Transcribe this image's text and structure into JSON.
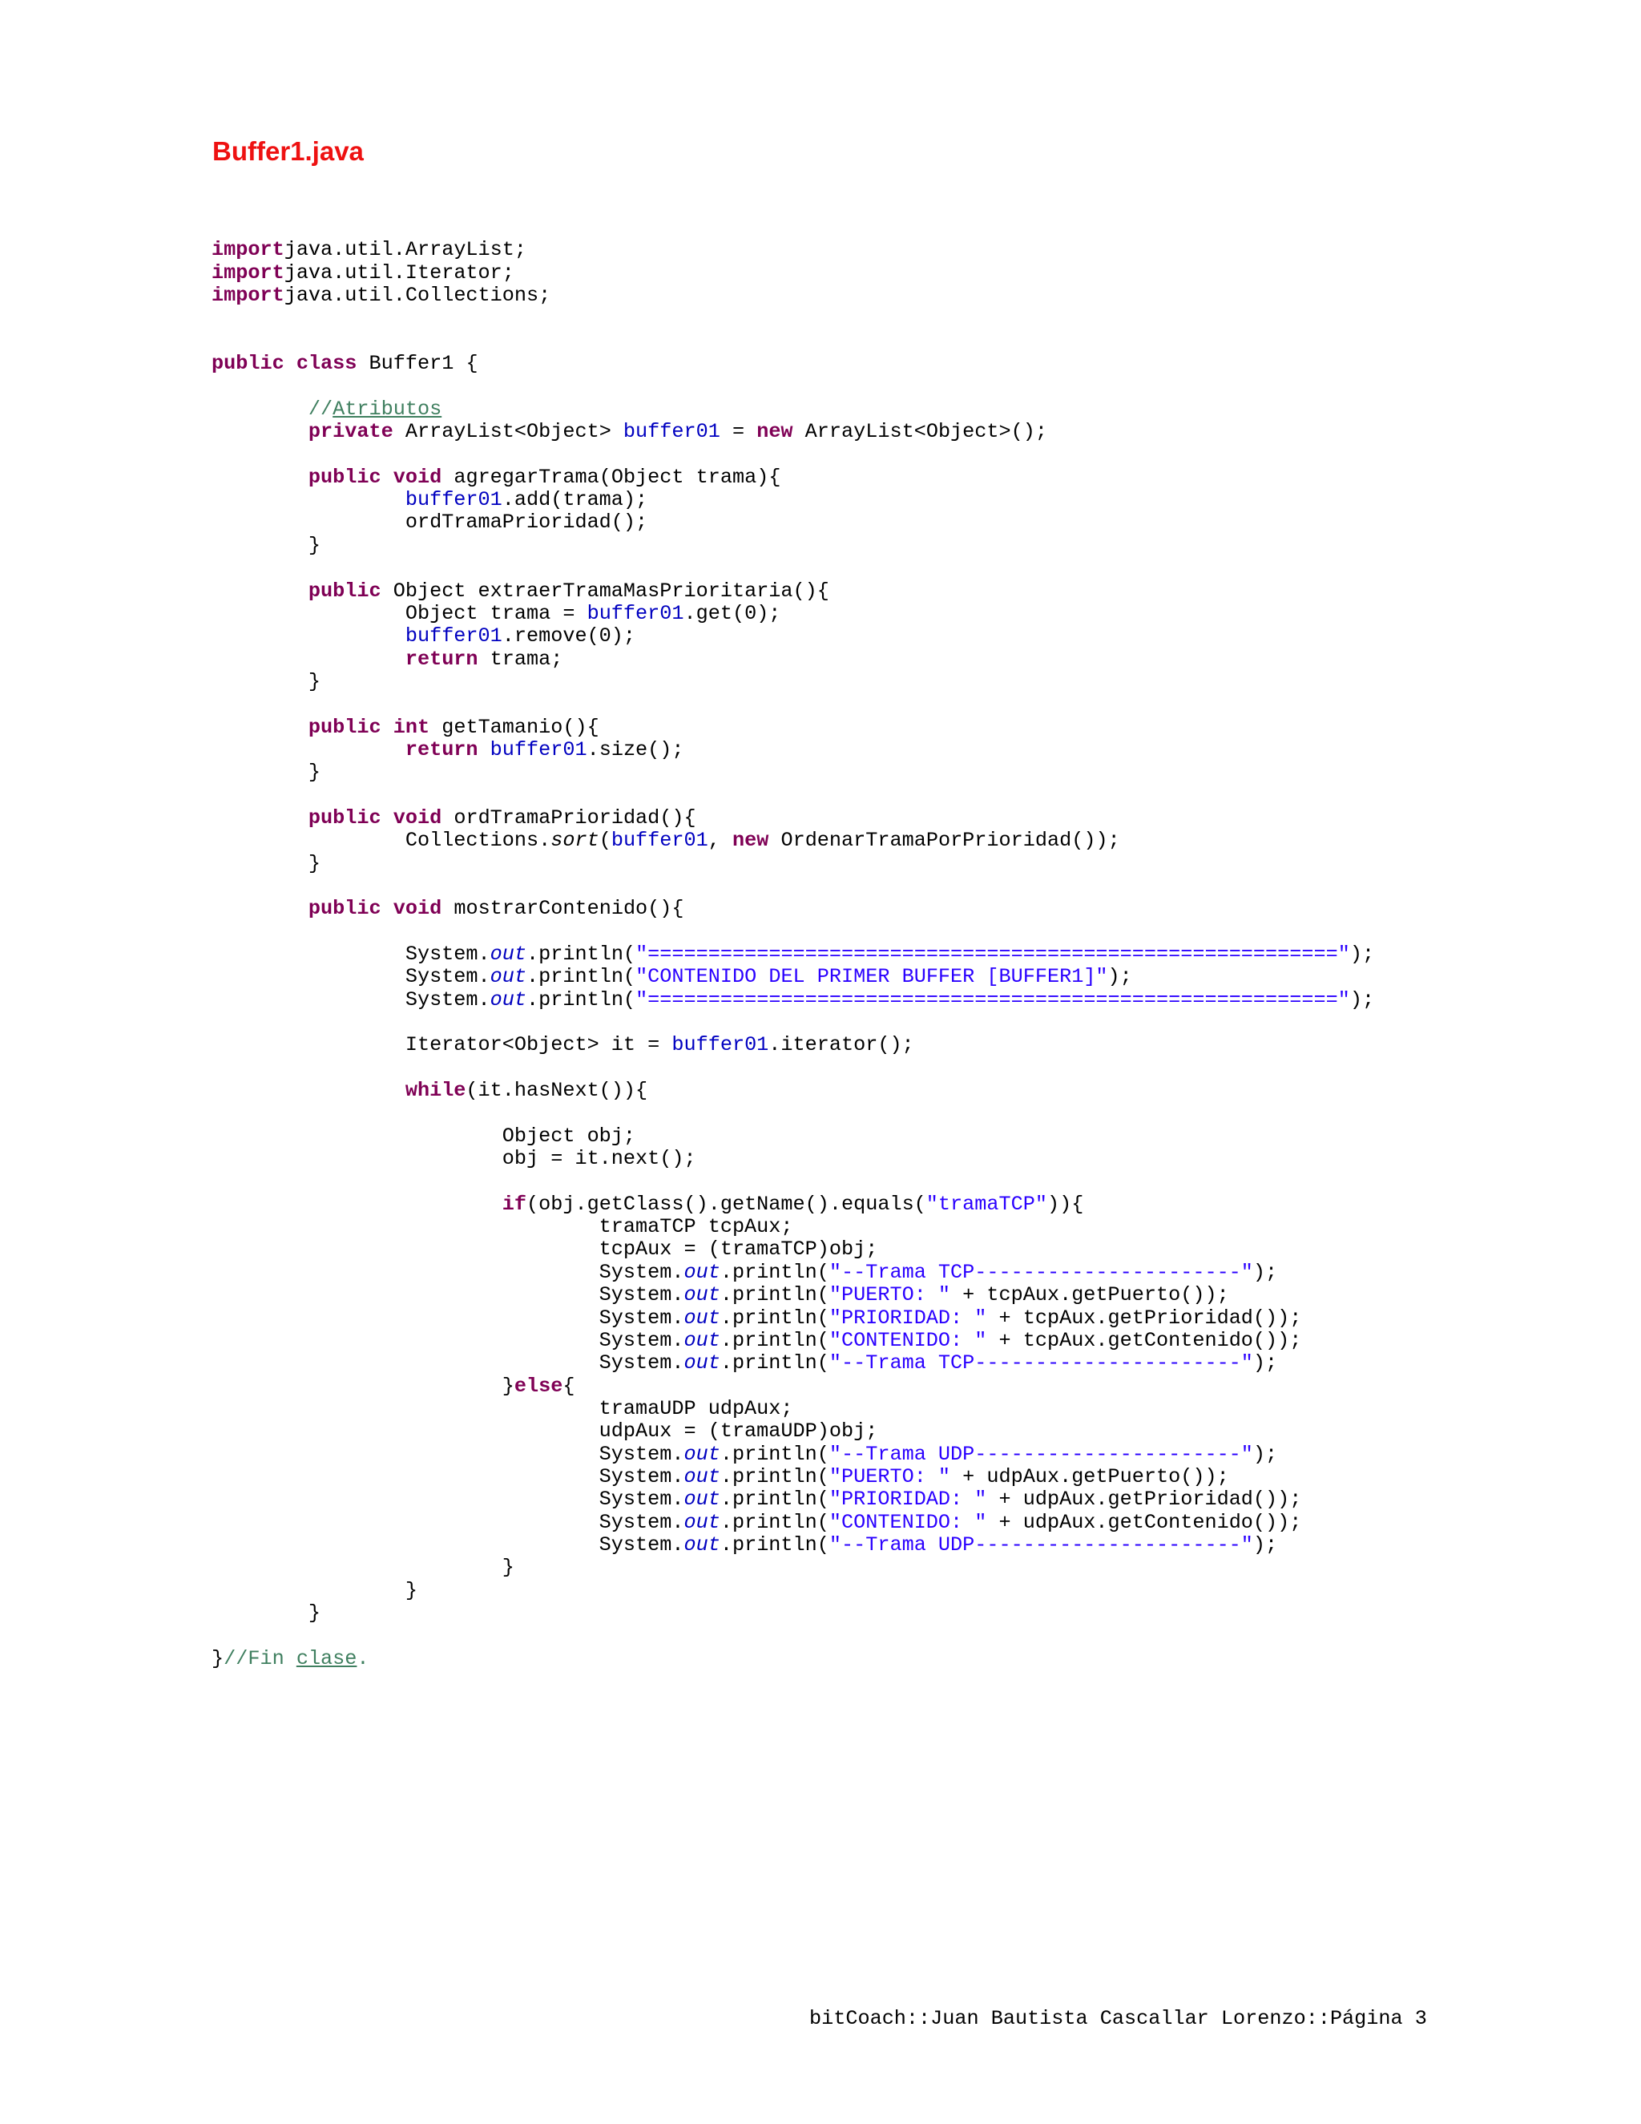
{
  "document": {
    "title": "Buffer1.java",
    "footer": "bitCoach::Juan Bautista Cascallar Lorenzo::Página 3"
  },
  "code": [
    [],
    [
      [
        "kw",
        "import"
      ],
      [
        "",
        "java.util.ArrayList;"
      ]
    ],
    [
      [
        "kw",
        "import"
      ],
      [
        "",
        "java.util.Iterator;"
      ]
    ],
    [
      [
        "kw",
        "import"
      ],
      [
        "",
        "java.util.Collections;"
      ]
    ],
    [],
    [],
    [
      [
        "kw",
        "public"
      ],
      [
        "",
        " "
      ],
      [
        "kw",
        "class"
      ],
      [
        "",
        " Buffer1 {"
      ]
    ],
    [],
    [
      [
        "",
        "        "
      ],
      [
        "cmt",
        "//"
      ],
      [
        "cmt-u",
        "Atributos"
      ]
    ],
    [
      [
        "",
        "        "
      ],
      [
        "kw",
        "private"
      ],
      [
        "",
        " ArrayList<Object> "
      ],
      [
        "fld",
        "buffer01"
      ],
      [
        "",
        " = "
      ],
      [
        "kw",
        "new"
      ],
      [
        "",
        " ArrayList<Object>();"
      ]
    ],
    [],
    [
      [
        "",
        "        "
      ],
      [
        "kw",
        "public"
      ],
      [
        "",
        " "
      ],
      [
        "kw",
        "void"
      ],
      [
        "",
        " agregarTrama(Object trama){"
      ]
    ],
    [
      [
        "",
        "                "
      ],
      [
        "fld",
        "buffer01"
      ],
      [
        "",
        ".add(trama);"
      ]
    ],
    [
      [
        "",
        "                ordTramaPrioridad();"
      ]
    ],
    [
      [
        "",
        "        }"
      ]
    ],
    [],
    [
      [
        "",
        "        "
      ],
      [
        "kw",
        "public"
      ],
      [
        "",
        " Object extraerTramaMasPrioritaria(){"
      ]
    ],
    [
      [
        "",
        "                Object trama = "
      ],
      [
        "fld",
        "buffer01"
      ],
      [
        "",
        ".get(0);"
      ]
    ],
    [
      [
        "",
        "                "
      ],
      [
        "fld",
        "buffer01"
      ],
      [
        "",
        ".remove(0);"
      ]
    ],
    [
      [
        "",
        "                "
      ],
      [
        "kw",
        "return"
      ],
      [
        "",
        " trama;"
      ]
    ],
    [
      [
        "",
        "        }"
      ]
    ],
    [],
    [
      [
        "",
        "        "
      ],
      [
        "kw",
        "public"
      ],
      [
        "",
        " "
      ],
      [
        "kw",
        "int"
      ],
      [
        "",
        " getTamanio(){"
      ]
    ],
    [
      [
        "",
        "                "
      ],
      [
        "kw",
        "return"
      ],
      [
        "",
        " "
      ],
      [
        "fld",
        "buffer01"
      ],
      [
        "",
        ".size();"
      ]
    ],
    [
      [
        "",
        "        }"
      ]
    ],
    [],
    [
      [
        "",
        "        "
      ],
      [
        "kw",
        "public"
      ],
      [
        "",
        " "
      ],
      [
        "kw",
        "void"
      ],
      [
        "",
        " ordTramaPrioridad(){"
      ]
    ],
    [
      [
        "",
        "                Collections."
      ],
      [
        "sm",
        "sort"
      ],
      [
        "",
        "("
      ],
      [
        "fld",
        "buffer01"
      ],
      [
        "",
        ", "
      ],
      [
        "kw",
        "new"
      ],
      [
        "",
        " OrdenarTramaPorPrioridad());"
      ]
    ],
    [
      [
        "",
        "        }"
      ]
    ],
    [],
    [
      [
        "",
        "        "
      ],
      [
        "kw",
        "public"
      ],
      [
        "",
        " "
      ],
      [
        "kw",
        "void"
      ],
      [
        "",
        " mostrarContenido(){"
      ]
    ],
    [],
    [
      [
        "",
        "                System."
      ],
      [
        "sfld",
        "out"
      ],
      [
        "",
        ".println("
      ],
      [
        "str",
        "\"=========================================================\""
      ],
      [
        "",
        ");"
      ]
    ],
    [
      [
        "",
        "                System."
      ],
      [
        "sfld",
        "out"
      ],
      [
        "",
        ".println("
      ],
      [
        "str",
        "\"CONTENIDO DEL PRIMER BUFFER [BUFFER1]\""
      ],
      [
        "",
        ");"
      ]
    ],
    [
      [
        "",
        "                System."
      ],
      [
        "sfld",
        "out"
      ],
      [
        "",
        ".println("
      ],
      [
        "str",
        "\"=========================================================\""
      ],
      [
        "",
        ");"
      ]
    ],
    [],
    [
      [
        "",
        "                Iterator<Object> it = "
      ],
      [
        "fld",
        "buffer01"
      ],
      [
        "",
        ".iterator();"
      ]
    ],
    [],
    [
      [
        "",
        "                "
      ],
      [
        "kw",
        "while"
      ],
      [
        "",
        "(it.hasNext()){"
      ]
    ],
    [],
    [
      [
        "",
        "                        Object obj;"
      ]
    ],
    [
      [
        "",
        "                        obj = it.next();"
      ]
    ],
    [],
    [
      [
        "",
        "                        "
      ],
      [
        "kw",
        "if"
      ],
      [
        "",
        "(obj.getClass().getName().equals("
      ],
      [
        "str",
        "\"tramaTCP\""
      ],
      [
        "",
        "))"
      ],
      [
        "",
        "{"
      ]
    ],
    [
      [
        "",
        "                                tramaTCP tcpAux;"
      ]
    ],
    [
      [
        "",
        "                                tcpAux = (tramaTCP)obj;"
      ]
    ],
    [
      [
        "",
        "                                System."
      ],
      [
        "sfld",
        "out"
      ],
      [
        "",
        ".println("
      ],
      [
        "str",
        "\"--Trama TCP----------------------\""
      ],
      [
        "",
        ");"
      ]
    ],
    [
      [
        "",
        "                                System."
      ],
      [
        "sfld",
        "out"
      ],
      [
        "",
        ".println("
      ],
      [
        "str",
        "\"PUERTO: \""
      ],
      [
        "",
        " + tcpAux.getPuerto());"
      ]
    ],
    [
      [
        "",
        "                                System."
      ],
      [
        "sfld",
        "out"
      ],
      [
        "",
        ".println("
      ],
      [
        "str",
        "\"PRIORIDAD: \""
      ],
      [
        "",
        " + tcpAux.getPrioridad());"
      ]
    ],
    [
      [
        "",
        "                                System."
      ],
      [
        "sfld",
        "out"
      ],
      [
        "",
        ".println("
      ],
      [
        "str",
        "\"CONTENIDO: \""
      ],
      [
        "",
        " + tcpAux.getContenido());"
      ]
    ],
    [
      [
        "",
        "                                System."
      ],
      [
        "sfld",
        "out"
      ],
      [
        "",
        ".println("
      ],
      [
        "str",
        "\"--Trama TCP----------------------\""
      ],
      [
        "",
        ");"
      ]
    ],
    [
      [
        "",
        "                        }"
      ],
      [
        "kw",
        "else"
      ],
      [
        "",
        "{"
      ]
    ],
    [
      [
        "",
        "                                tramaUDP udpAux;"
      ]
    ],
    [
      [
        "",
        "                                udpAux = (tramaUDP)obj;"
      ]
    ],
    [
      [
        "",
        "                                System."
      ],
      [
        "sfld",
        "out"
      ],
      [
        "",
        ".println("
      ],
      [
        "str",
        "\"--Trama UDP----------------------\""
      ],
      [
        "",
        ");"
      ]
    ],
    [
      [
        "",
        "                                System."
      ],
      [
        "sfld",
        "out"
      ],
      [
        "",
        ".println("
      ],
      [
        "str",
        "\"PUERTO: \""
      ],
      [
        "",
        " + udpAux.getPuerto());"
      ]
    ],
    [
      [
        "",
        "                                System."
      ],
      [
        "sfld",
        "out"
      ],
      [
        "",
        ".println("
      ],
      [
        "str",
        "\"PRIORIDAD: \""
      ],
      [
        "",
        " + udpAux.getPrioridad());"
      ]
    ],
    [
      [
        "",
        "                                System."
      ],
      [
        "sfld",
        "out"
      ],
      [
        "",
        ".println("
      ],
      [
        "str",
        "\"CONTENIDO: \""
      ],
      [
        "",
        " + udpAux.getContenido());"
      ]
    ],
    [
      [
        "",
        "                                System."
      ],
      [
        "sfld",
        "out"
      ],
      [
        "",
        ".println("
      ],
      [
        "str",
        "\"--Trama UDP----------------------\""
      ],
      [
        "",
        ");"
      ]
    ],
    [
      [
        "",
        "                        }"
      ]
    ],
    [
      [
        "",
        "                }"
      ]
    ],
    [
      [
        "",
        "        }"
      ]
    ],
    [],
    [
      [
        "",
        "}"
      ],
      [
        "cmt",
        "//Fin "
      ],
      [
        "cmt-u",
        "clase"
      ],
      [
        "cmt",
        "."
      ]
    ]
  ]
}
